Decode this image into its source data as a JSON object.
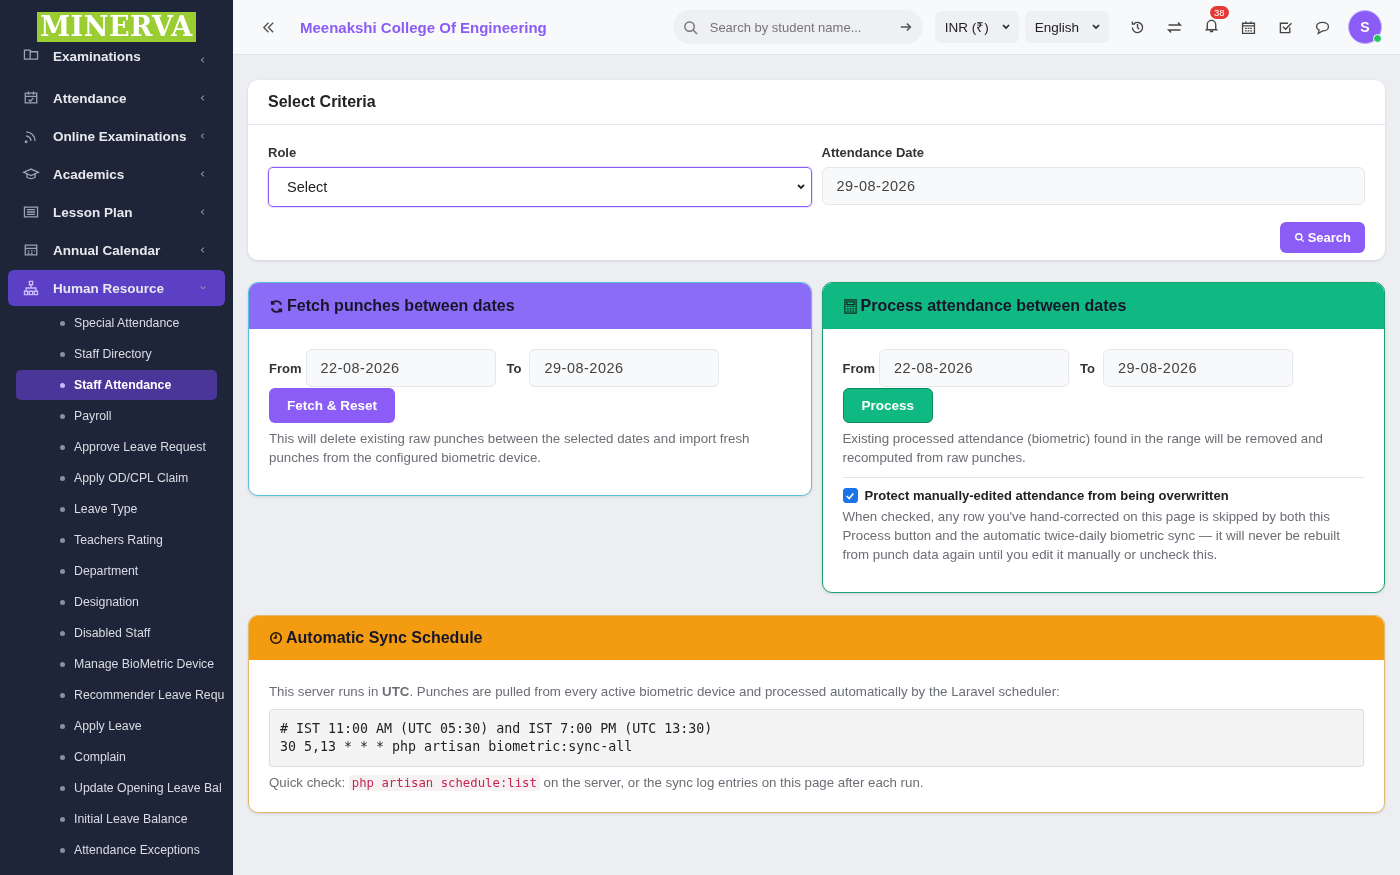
{
  "sidebar": {
    "logo": "MINERVA",
    "items": [
      {
        "label": "Examinations",
        "expanded": false
      },
      {
        "label": "Attendance",
        "expanded": false
      },
      {
        "label": "Online Examinations",
        "expanded": false
      },
      {
        "label": "Academics",
        "expanded": false
      },
      {
        "label": "Lesson Plan",
        "expanded": false
      },
      {
        "label": "Annual Calendar",
        "expanded": false
      },
      {
        "label": "Human Resource",
        "expanded": true,
        "children": [
          {
            "label": "Special Attendance",
            "selected": false
          },
          {
            "label": "Staff Directory",
            "selected": false
          },
          {
            "label": "Staff Attendance",
            "selected": true
          },
          {
            "label": "Payroll",
            "selected": false
          },
          {
            "label": "Approve Leave Request",
            "selected": false
          },
          {
            "label": "Apply OD/CPL Claim",
            "selected": false
          },
          {
            "label": "Leave Type",
            "selected": false
          },
          {
            "label": "Teachers Rating",
            "selected": false
          },
          {
            "label": "Department",
            "selected": false
          },
          {
            "label": "Designation",
            "selected": false
          },
          {
            "label": "Disabled Staff",
            "selected": false
          },
          {
            "label": "Manage BioMetric Device",
            "selected": false
          },
          {
            "label": "Recommender Leave Requ",
            "selected": false
          },
          {
            "label": "Apply Leave",
            "selected": false
          },
          {
            "label": "Complain",
            "selected": false
          },
          {
            "label": "Update Opening Leave Bal",
            "selected": false
          },
          {
            "label": "Initial Leave Balance",
            "selected": false
          },
          {
            "label": "Attendance Exceptions",
            "selected": false
          }
        ]
      }
    ]
  },
  "header": {
    "title": "Meenakshi College Of Engineering",
    "search": {
      "placeholder": "Search by student name..."
    },
    "currency": "INR (₹)",
    "language": "English",
    "notifications": "38",
    "avatar": "S"
  },
  "criteria": {
    "title": "Select Criteria",
    "role_label": "Role",
    "role_value": "Select",
    "date_label": "Attendance Date",
    "date_value": "29-08-2026",
    "search_button": "Search"
  },
  "fetch": {
    "title": "Fetch punches between dates",
    "from_label": "From",
    "from": "22-08-2026",
    "to_label": "To",
    "to": "29-08-2026",
    "button": "Fetch & Reset",
    "note": "This will delete existing raw punches between the selected dates and import fresh punches from the configured biometric device."
  },
  "process": {
    "title": "Process attendance between dates",
    "from_label": "From",
    "from": "22-08-2026",
    "to_label": "To",
    "to": "29-08-2026",
    "button": "Process",
    "note": "Existing processed attendance (biometric) found in the range will be removed and recomputed from raw punches.",
    "protect": {
      "label": "Protect manually-edited attendance from being overwritten",
      "checked": true
    },
    "protect_note": "When checked, any row you've hand-corrected on this page is skipped by both this Process button and the automatic twice-daily biometric sync — it will never be rebuilt from punch data again until you edit it manually or uncheck this."
  },
  "sync": {
    "title": "Automatic Sync Schedule",
    "intro": "This server runs in **UTC**. Punches are pulled from every active biometric device and processed automatically by the Laravel scheduler:",
    "code": [
      "# IST 11:00 AM (UTC 05:30) and IST 7:00 PM (UTC 13:30)",
      "30 5,13 * * *  php artisan biometric:sync-all"
    ],
    "quick_check": {
      "before": "Quick check:",
      "code": "php artisan schedule:list",
      "after": "on the server, or the sync log entries on this page after each run."
    }
  }
}
